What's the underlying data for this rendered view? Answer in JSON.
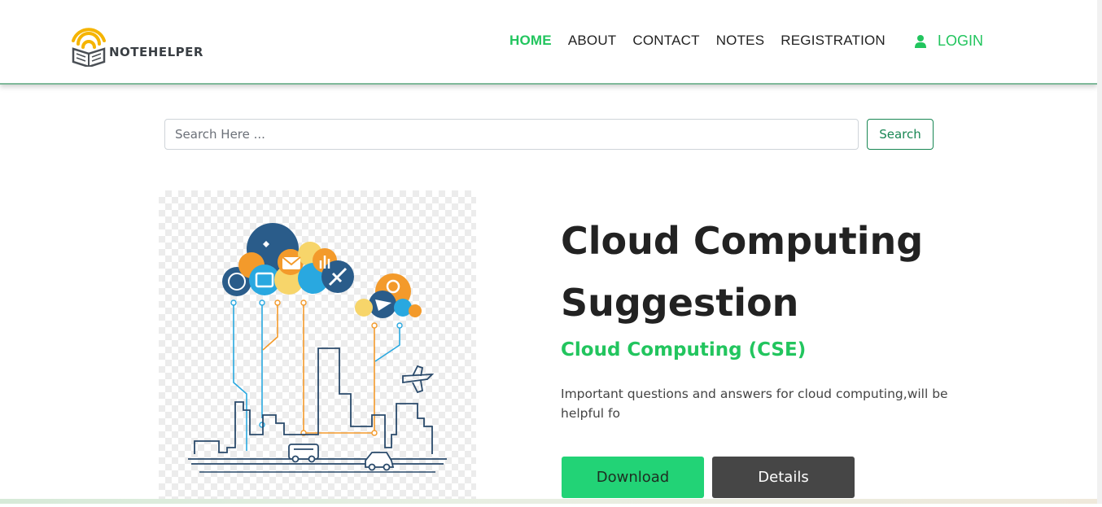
{
  "brand": {
    "name": "NOTEHELPER",
    "icon": "book-wifi-logo",
    "accent": "#22c55e",
    "logo_yellow": "#f5b400"
  },
  "nav": {
    "items": [
      {
        "label": "HOME",
        "active": true
      },
      {
        "label": "ABOUT",
        "active": false
      },
      {
        "label": "CONTACT",
        "active": false
      },
      {
        "label": "NOTES",
        "active": false
      },
      {
        "label": "REGISTRATION",
        "active": false
      }
    ],
    "login": {
      "label": "LOGIN",
      "icon": "user-icon"
    }
  },
  "search": {
    "placeholder": "Search Here ...",
    "value": "",
    "button_label": "Search"
  },
  "note": {
    "title": "Cloud Computing Suggestion",
    "subject": "Cloud Computing (CSE)",
    "description": "Important questions and answers for cloud computing,will be helpful fo",
    "download_label": "Download",
    "details_label": "Details",
    "image": "cloud-computing-city-illustration"
  }
}
